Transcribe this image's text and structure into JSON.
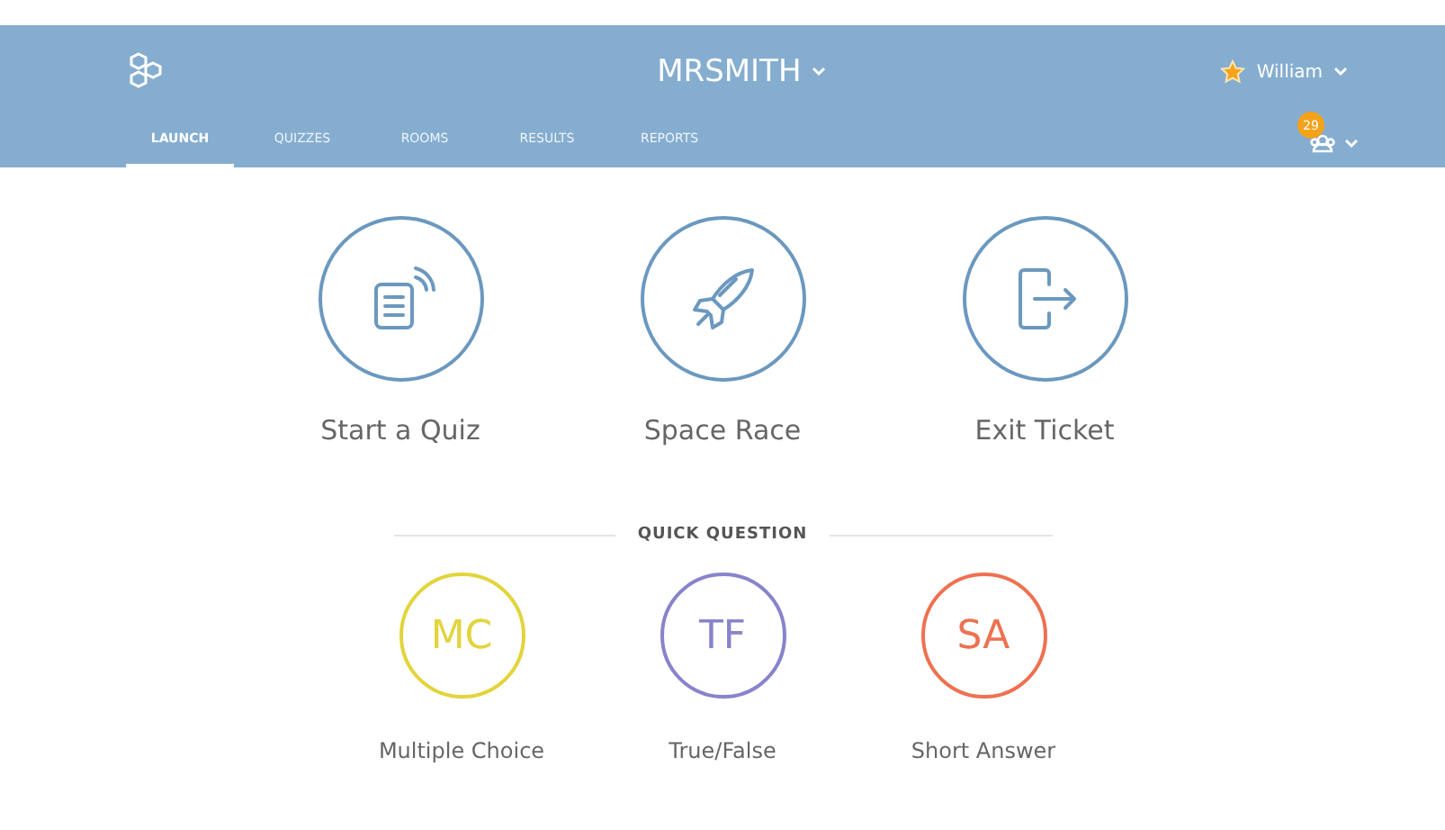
{
  "header": {
    "title": "MRSMITH",
    "user": "William",
    "badge": "29"
  },
  "tabs": [
    {
      "label": "LAUNCH",
      "selected": true
    },
    {
      "label": "QUIZZES",
      "selected": false
    },
    {
      "label": "ROOMS",
      "selected": false
    },
    {
      "label": "RESULTS",
      "selected": false
    },
    {
      "label": "REPORTS",
      "selected": false
    }
  ],
  "activities": [
    {
      "kind": "quiz",
      "label": "Start a Quiz"
    },
    {
      "kind": "rocket",
      "label": "Space Race"
    },
    {
      "kind": "exit",
      "label": "Exit Ticket"
    }
  ],
  "quick_question": {
    "heading": "QUICK QUESTION",
    "items": [
      {
        "abbr": "MC",
        "label": "Multiple Choice",
        "color": "#e2d43c"
      },
      {
        "abbr": "TF",
        "label": "True/False",
        "color": "#8883cc"
      },
      {
        "abbr": "SA",
        "label": "Short Answer",
        "color": "#ee7150"
      }
    ]
  }
}
